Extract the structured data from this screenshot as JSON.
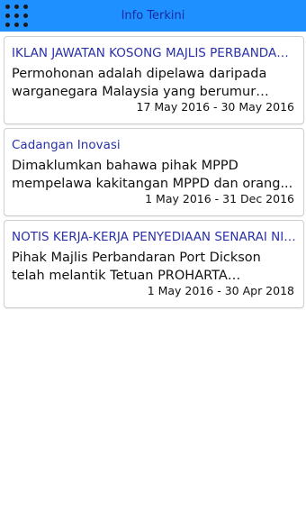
{
  "header": {
    "title": "Info Terkini",
    "menu_icon": "grid-dots-icon",
    "bar_color": "#1e90ff",
    "title_color": "#1a2aa0"
  },
  "news": [
    {
      "title": "IKLAN JAWATAN KOSONG MAJLIS PERBANDARAN ...",
      "description": "Permohonan adalah dipelawa daripada warganegara Malaysia yang berumur tidak...",
      "date_range": "17 May 2016 - 30 May 2016"
    },
    {
      "title": "Cadangan Inovasi",
      "description": "Dimaklumkan bahawa pihak MPPD mempelawa kakitangan MPPD dan orang...",
      "date_range": "1 May 2016 - 31 Dec 2016"
    },
    {
      "title": "NOTIS KERJA-KERJA PENYEDIAAN SENARAI NILAI...",
      "description": "Pihak Majlis Perbandaran Port Dickson telah melantik Tetuan PROHARTA CONSULTANCY...",
      "date_range": "1 May 2016 - 30 Apr 2018"
    }
  ]
}
